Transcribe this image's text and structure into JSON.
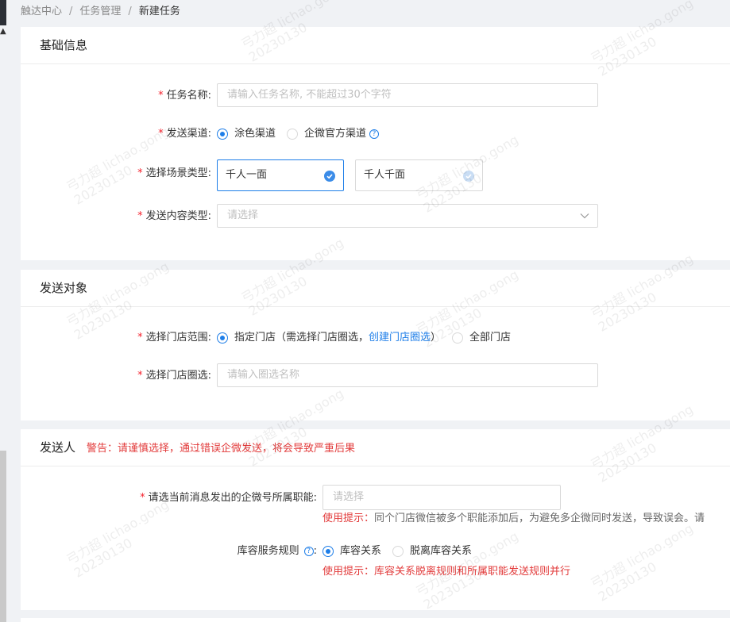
{
  "breadcrumb": [
    "触达中心",
    "任务管理",
    "新建任务"
  ],
  "watermark": {
    "line1": "弓力超 lichao.gong",
    "line2": "20230130"
  },
  "basic": {
    "title": "基础信息",
    "task_name": {
      "label": "任务名称:",
      "placeholder": "请输入任务名称, 不能超过30个字符"
    },
    "channel": {
      "label": "发送渠道:",
      "options": [
        "涂色渠道",
        "企微官方渠道"
      ],
      "selected": "涂色渠道"
    },
    "scene": {
      "label": "选择场景类型:",
      "options": [
        "千人一面",
        "千人千面"
      ],
      "selected": "千人一面"
    },
    "content_type": {
      "label": "发送内容类型:",
      "placeholder": "请选择"
    }
  },
  "target": {
    "title": "发送对象",
    "store_range": {
      "label": "选择门店范围:",
      "option1_text": "指定门店（需选择门店圈选，",
      "option1_link": "创建门店圈选",
      "option1_suffix": "）",
      "option2": "全部门店",
      "selected": "指定门店"
    },
    "store_circle": {
      "label": "选择门店圈选:",
      "placeholder": "请输入圈选名称"
    }
  },
  "sender": {
    "title": "发送人",
    "warning": "警告：请谨慎选择，通过错误企微发送，将会导致严重后果",
    "role": {
      "label": "请选当前消息发出的企微号所属职能:",
      "placeholder": "请选择",
      "hint_label": "使用提示：",
      "hint_text": "同个门店微信被多个职能添加后，为避免多企微同时发送，导致误会。请"
    },
    "rule": {
      "label": "库容服务规则",
      "options": [
        "库容关系",
        "脱离库容关系"
      ],
      "selected": "库容关系",
      "hint": "使用提示：库容关系脱离规则和所属职能发送规则并行"
    }
  },
  "colors": {
    "primary": "#1e7ee8",
    "danger": "#e23b3b",
    "background": "#f0f2f5"
  }
}
